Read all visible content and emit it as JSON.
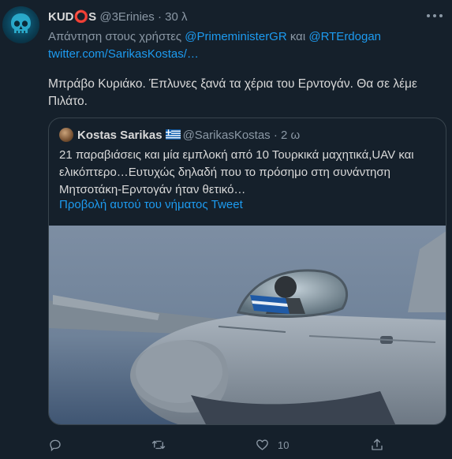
{
  "tweet": {
    "author_name": "KUD⭕S",
    "author_handle": "@3Erinies",
    "separator": "·",
    "time": "30 λ",
    "reply_prefix": "Απάντηση στους χρήστες",
    "reply_user_1": "@PrimeministerGR",
    "reply_and": "και",
    "reply_user_2": "@RTErdogan",
    "reply_link": "twitter.com/SarikasKostas/…",
    "text": "Μπράβο Κυριάκο. Έπλυνες ξανά τα χέρια του Ερντογάν. Θα σε λέμε Πιλάτο."
  },
  "quoted": {
    "author_name": "Kostas Sarikas",
    "flag_icon": "greek-flag-icon",
    "author_handle": "@SarikasKostas",
    "separator": "·",
    "time": "2 ω",
    "text": "21 παραβιάσεις και μία εμπλοκή από 10 Τουρκικά μαχητικά,UAV και ελικόπτερο…Ευτυχώς δηλαδή που το πρόσημο στη συνάντηση Μητσοτάκη-Ερντογάν ήταν θετικό…",
    "show_thread": "Προβολή αυτού του νήματος Tweet"
  },
  "actions": {
    "reply_icon": "reply-icon",
    "retweet_icon": "retweet-icon",
    "like_icon": "heart-icon",
    "like_count": "10",
    "share_icon": "share-icon"
  },
  "colors": {
    "background": "#15202b",
    "border": "#38444d",
    "link": "#1d9bf0",
    "muted": "#8b98a5",
    "text": "#d9d9d9"
  }
}
